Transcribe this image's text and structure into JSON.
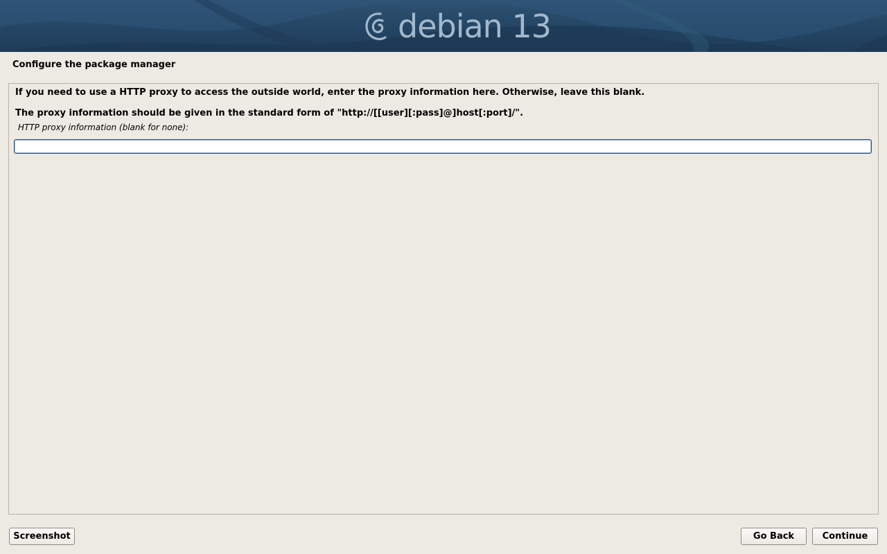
{
  "header": {
    "logo_text": "debian 13",
    "brand_color": "#a3b8cc",
    "banner_color": "#244564",
    "logo_icon": "debian-swirl-icon"
  },
  "page": {
    "title": "Configure the package manager"
  },
  "content": {
    "paragraph_1": "If you need to use a HTTP proxy to access the outside world, enter the proxy information here. Otherwise, leave this blank.",
    "paragraph_2": "The proxy information should be given in the standard form of \"http://[[user][:pass]@]host[:port]/\".",
    "field_label": "HTTP proxy information (blank for none):",
    "field_value": "",
    "field_placeholder": ""
  },
  "buttons": {
    "screenshot": "Screenshot",
    "go_back": "Go Back",
    "continue": "Continue"
  }
}
